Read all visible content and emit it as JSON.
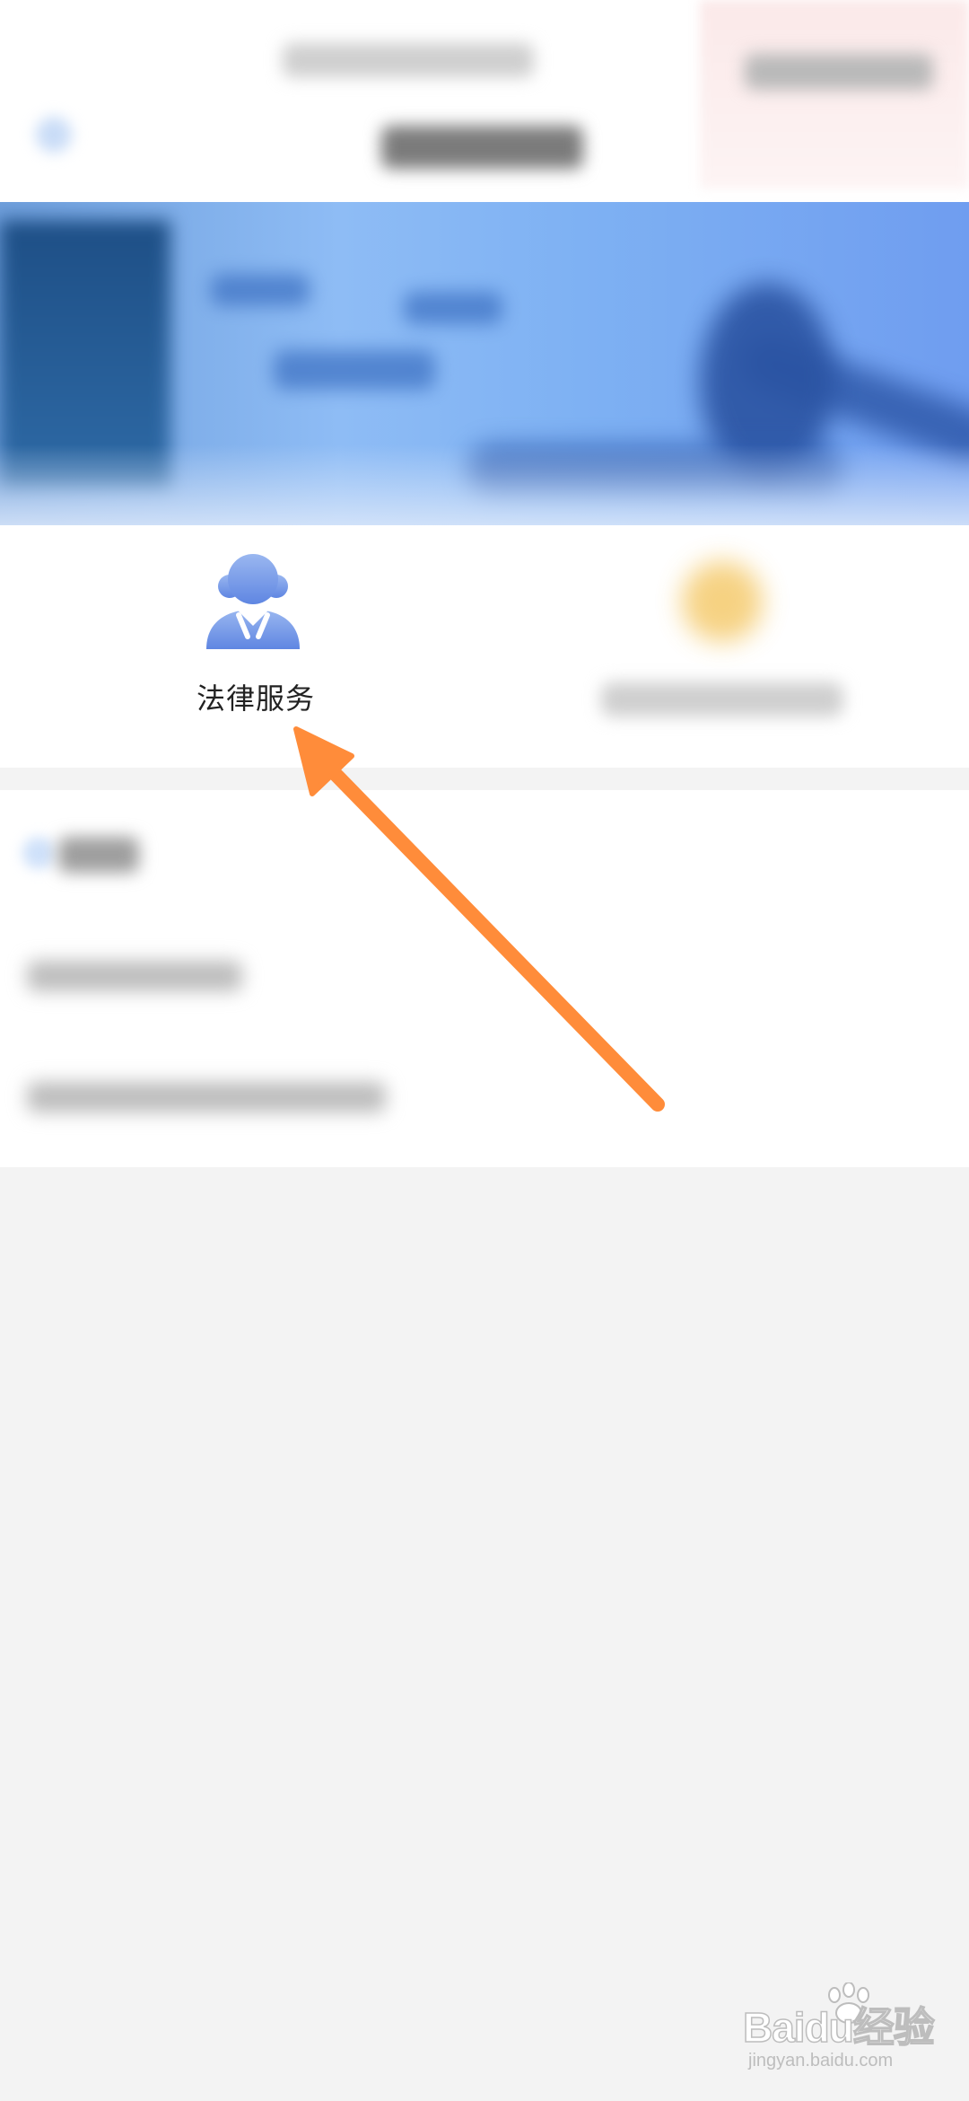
{
  "services": {
    "items": [
      {
        "label": "法律服务",
        "icon": "lawyer-icon"
      }
    ]
  },
  "annotation": {
    "color": "#ff8c3a"
  },
  "watermark": {
    "brand": "Baidu经验",
    "url": "jingyan.baidu.com"
  },
  "colors": {
    "legal_icon": "#6f95e6",
    "banner_blue": "#8ebcf5"
  }
}
